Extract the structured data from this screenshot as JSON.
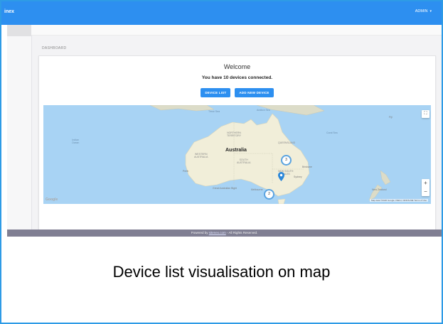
{
  "topbar": {
    "brand": "inex",
    "user_label": "ADMIN",
    "caret": "▾"
  },
  "breadcrumb": "DASHBOARD",
  "welcome": {
    "title": "Welcome",
    "message": "You have 10 devices connected.",
    "device_list_button": "DEVICE LIST",
    "add_device_button": "ADD NEW DEVICE"
  },
  "map": {
    "country_label": "Australia",
    "region_labels": {
      "timor_sea": "Timor Sea",
      "arafura_sea": "Arafura Sea",
      "coral_sea": "Coral Sea",
      "indian_ocean": "Indian\nOcean",
      "northern_territory": "NORTHERN\nTERRITORY",
      "queensland": "QUEENSLAND",
      "western_australia": "WESTERN\nAUSTRALIA",
      "south_australia": "SOUTH\nAUSTRALIA",
      "new_south_wales": "NEW SOUTH\nWALES",
      "great_australian_bight": "Great Australian Bight",
      "perth": "Perth",
      "brisbane": "Brisbane",
      "sydney": "Sydney",
      "melbourne": "Melbourne",
      "fiji": "Fiji",
      "new_zealand": "New Zealand"
    },
    "clusters": [
      {
        "count": "3"
      },
      {
        "count": "2"
      }
    ],
    "google_label": "Google",
    "attribution": "Map data ©2020 Google, INEGI, ORION-ME  Terms of Use",
    "fullscreen_icon": "⛶",
    "zoom_in": "+",
    "zoom_out": "−"
  },
  "footer": {
    "prefix": "Powered by ",
    "link": "sitenex.com",
    "suffix": " - All Rights Reserved."
  },
  "caption": "Device list visualisation on map"
}
